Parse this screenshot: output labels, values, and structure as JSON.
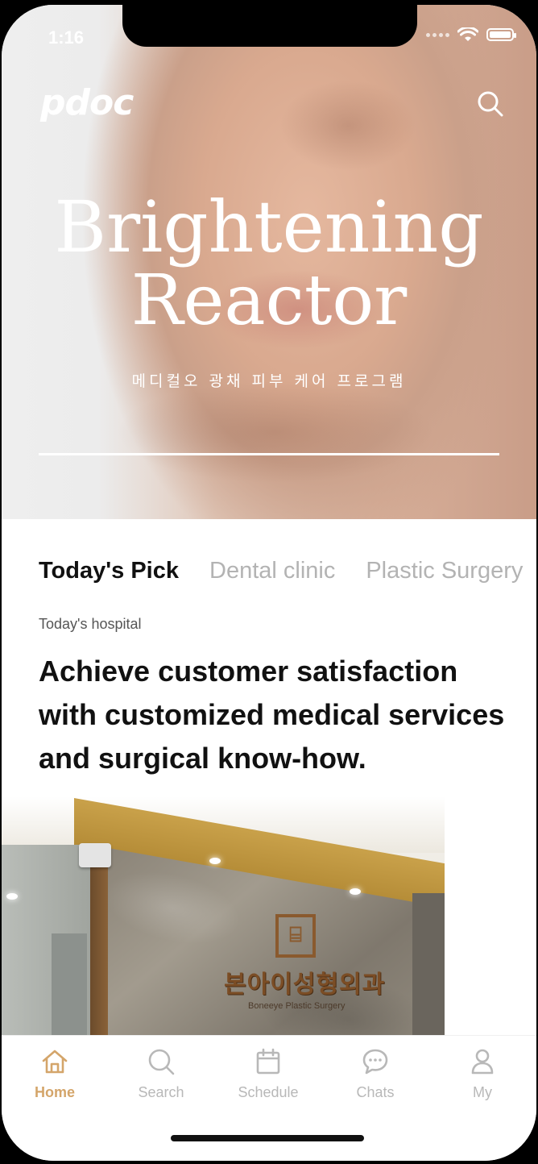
{
  "status_bar": {
    "time": "1:16"
  },
  "header": {
    "logo": "pdoc",
    "search_icon": "search-icon"
  },
  "hero": {
    "title_line1": "Brightening",
    "title_line2": "Reactor",
    "subtitle": "메디컬오 광채 피부 케어 프로그램"
  },
  "tabs": [
    {
      "label": "Today's Pick",
      "active": true
    },
    {
      "label": "Dental clinic",
      "active": false
    },
    {
      "label": "Plastic Surgery",
      "active": false
    }
  ],
  "feature": {
    "section_label": "Today's hospital",
    "headline": "Achieve customer satisfaction with customized medical services and surgical know-how.",
    "image_sign_ko": "본아이성형외과",
    "image_sign_en": "Boneeye Plastic Surgery"
  },
  "bottom_nav": {
    "items": [
      {
        "label": "Home",
        "icon": "home-icon",
        "active": true
      },
      {
        "label": "Search",
        "icon": "search-icon",
        "active": false
      },
      {
        "label": "Schedule",
        "icon": "calendar-icon",
        "active": false
      },
      {
        "label": "Chats",
        "icon": "chat-bubble-icon",
        "active": false
      },
      {
        "label": "My",
        "icon": "person-icon",
        "active": false
      }
    ]
  },
  "colors": {
    "accent": "#d4a56a",
    "inactive": "#b8b8b8",
    "text": "#111111"
  }
}
